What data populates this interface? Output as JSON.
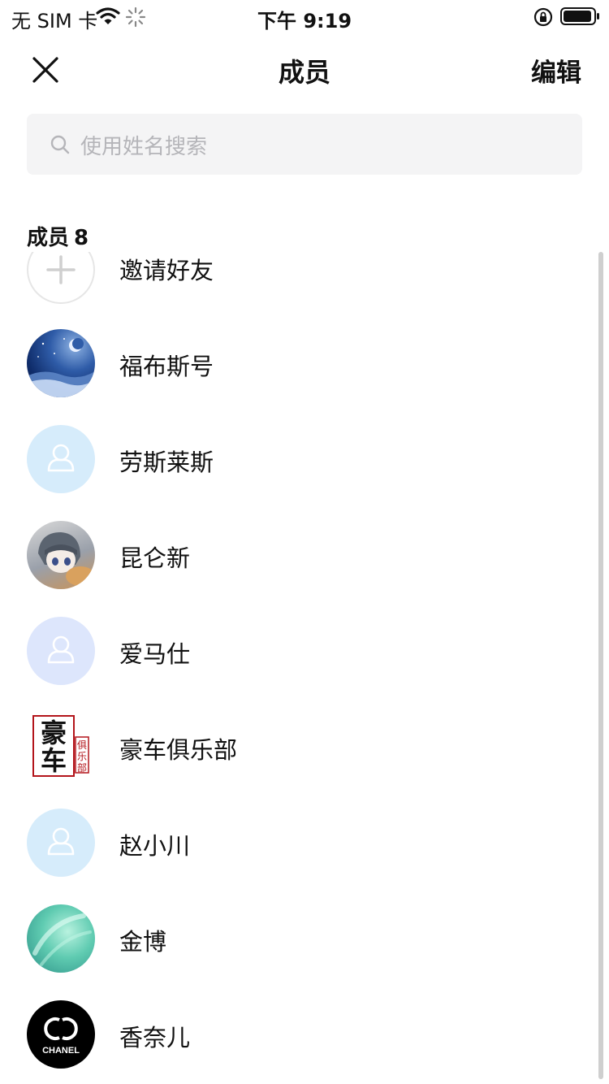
{
  "status_bar": {
    "carrier": "无 SIM 卡",
    "time": "下午 9:19"
  },
  "nav": {
    "title": "成员",
    "edit_label": "编辑"
  },
  "search": {
    "placeholder": "使用姓名搜索"
  },
  "section": {
    "label": "成员",
    "count": "8"
  },
  "invite": {
    "label": "邀请好友",
    "icon": "plus-icon"
  },
  "members": [
    {
      "name": "福布斯号",
      "avatar": "night-sky-moon-avatar"
    },
    {
      "name": "劳斯莱斯",
      "avatar": "default-person-avatar"
    },
    {
      "name": "昆仑新",
      "avatar": "anime-character-avatar"
    },
    {
      "name": "爱马仕",
      "avatar": "default-person-avatar"
    },
    {
      "name": "豪车俱乐部",
      "avatar": "calligraphy-seal-avatar"
    },
    {
      "name": "赵小川",
      "avatar": "default-person-avatar"
    },
    {
      "name": "金博",
      "avatar": "teal-gradient-avatar"
    },
    {
      "name": "香奈儿",
      "avatar": "chanel-logo-avatar"
    }
  ],
  "brand_logo_text": "CHANEL",
  "seal_text": "豪车俱乐部",
  "colors": {
    "search_bg": "#f4f4f5",
    "placeholder": "#b5b5b9",
    "default_avatar_blue": "#d6ecfb",
    "default_avatar_lavender": "#dde6fc"
  }
}
